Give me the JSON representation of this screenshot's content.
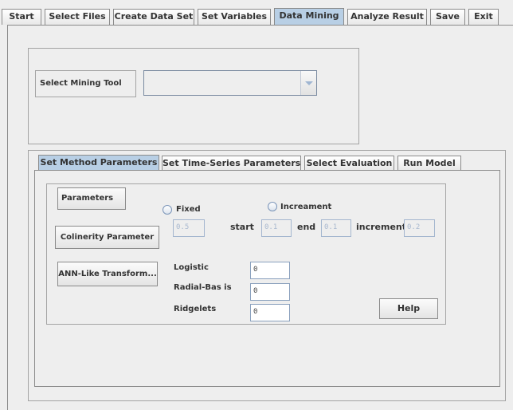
{
  "top_tabs": [
    "Start",
    "Select Files",
    "Create Data Set",
    "Set Variables",
    "Data Mining",
    "Analyze Result",
    "Save",
    "Exit"
  ],
  "active_top_tab": "Data Mining",
  "mining_tool": {
    "label": "Select Mining Tool",
    "value": ""
  },
  "inner_tabs": [
    "Set Method Parameters",
    "Set Time-Series Parameters",
    "Select Evaluation",
    "Run Model"
  ],
  "active_inner_tab": "Set Method Parameters",
  "params": {
    "parameters_button": "Parameters",
    "colinearity_button": "Colinerity Parameter",
    "ann_button": "ANN-Like Transform...",
    "fixed_label": "Fixed",
    "increment_radio_label": "Increament",
    "fixed_value": "0.5",
    "start_label": "start",
    "start_value": "0.1",
    "end_label": "end",
    "end_value": "0.1",
    "increment_label": "increment",
    "increment_value": "0.2",
    "logistic_label": "Logistic",
    "logistic_value": "0",
    "radial_label": "Radial-Bas is",
    "radial_value": "0",
    "ridgelets_label": "Ridgelets",
    "ridgelets_value": "0",
    "help_button": "Help"
  }
}
